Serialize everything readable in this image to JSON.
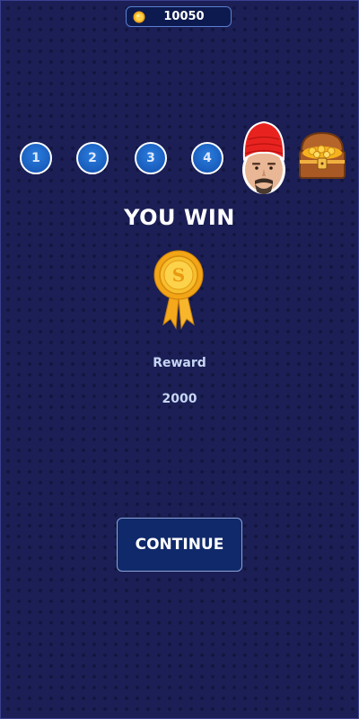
{
  "coins": {
    "value": "10050",
    "icon": "coin-icon"
  },
  "levels": [
    {
      "label": "1"
    },
    {
      "label": "2"
    },
    {
      "label": "3"
    },
    {
      "label": "4"
    }
  ],
  "title": "YOU WIN",
  "reward": {
    "label": "Reward",
    "value": "2000"
  },
  "continue_label": "CONTINUE",
  "colors": {
    "background": "#1b1f55",
    "level_circle": "#1a5fc4",
    "button": "#10296a",
    "gold": "#f5b21d",
    "hat": "#e8231f"
  }
}
